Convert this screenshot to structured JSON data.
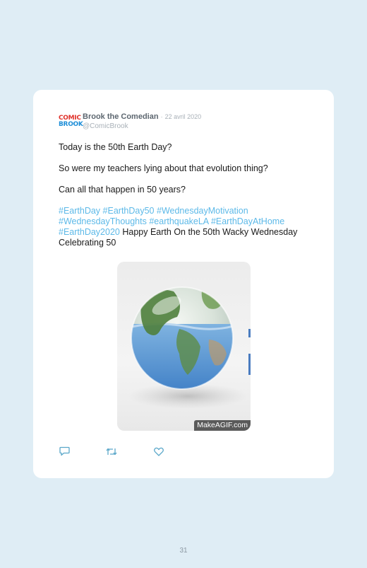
{
  "tweet": {
    "avatar": {
      "line1": "COMIC",
      "line2": "BROOK"
    },
    "display_name": "Brook the Comedian",
    "separator": "·",
    "date": "22 avril 2020",
    "handle": "@ComicBrook",
    "paragraphs": {
      "p1": "Today is the 50th Earth Day?",
      "p2": "So were my teachers lying about that evolution thing?",
      "p3": "Can all that happen in 50 years?"
    },
    "hashtags": {
      "h1": "#EarthDay",
      "h2": "#EarthDay50",
      "h3": "#WednesdayMotivation",
      "h4": "#WednesdayThoughts",
      "h5": "#earthquakeLA",
      "h6": "#EarthDayAtHome",
      "h7": "#EarthDay2020"
    },
    "trailing_text": "Happy Earth On the 50th Wacky Wednesday Celebrating 50",
    "media": {
      "watermark": "MakeAGIF.com",
      "description_icon": "globe-in-water-icon"
    },
    "actions": {
      "reply_icon": "reply-icon",
      "retweet_icon": "retweet-icon",
      "like_icon": "heart-icon"
    }
  },
  "page_number": "31",
  "colors": {
    "background": "#dfedf5",
    "card": "#ffffff",
    "hashtag": "#5cb9e8",
    "muted": "#a9b1b8",
    "name": "#5d6770",
    "icon": "#5aa7c9"
  }
}
